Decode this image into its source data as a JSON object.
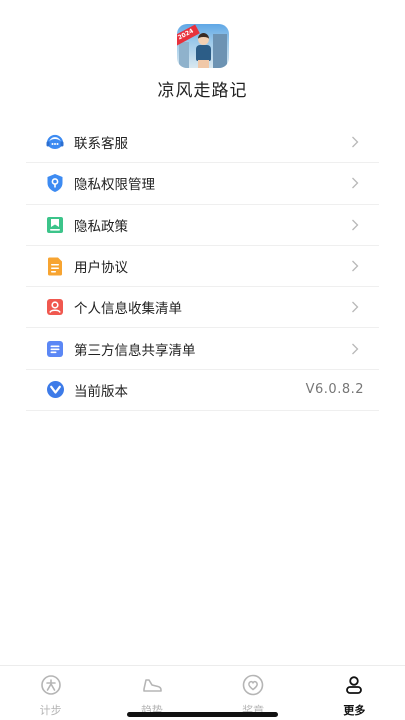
{
  "app": {
    "title": "凉风走路记",
    "icon_name": "app-logo-icon",
    "icon_badge": "2024"
  },
  "menu": {
    "items": [
      {
        "label": "联系客服",
        "icon": "customer-service-icon",
        "color": "#3d8bf2"
      },
      {
        "label": "隐私权限管理",
        "icon": "privacy-shield-icon",
        "color": "#3d8bf2"
      },
      {
        "label": "隐私政策",
        "icon": "policy-bookmark-icon",
        "color": "#3cc48a"
      },
      {
        "label": "用户协议",
        "icon": "agreement-document-icon",
        "color": "#f7a431"
      },
      {
        "label": "个人信息收集清单",
        "icon": "personal-info-icon",
        "color": "#f0584f"
      },
      {
        "label": "第三方信息共享清单",
        "icon": "third-party-list-icon",
        "color": "#5b87f5"
      }
    ],
    "version": {
      "label": "当前版本",
      "value": "V6.0.8.2",
      "icon": "version-icon",
      "color": "#3d7be8"
    }
  },
  "tabbar": {
    "tabs": [
      {
        "label": "计步",
        "icon": "step-count-icon",
        "active": false
      },
      {
        "label": "趋势",
        "icon": "trend-shoe-icon",
        "active": false
      },
      {
        "label": "奖章",
        "icon": "medal-heart-icon",
        "active": false
      },
      {
        "label": "更多",
        "icon": "more-person-icon",
        "active": true
      }
    ],
    "active_color": "#111111",
    "inactive_color": "#b5b5b5"
  }
}
